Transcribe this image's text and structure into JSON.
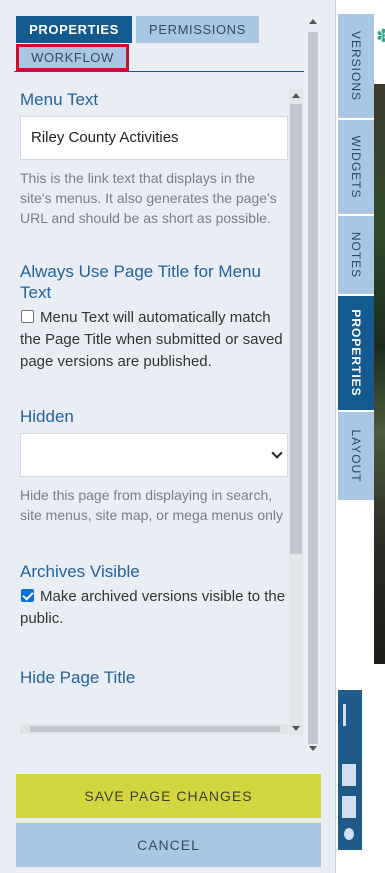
{
  "tabs": {
    "properties": "PROPERTIES",
    "permissions": "PERMISSIONS",
    "workflow": "WORKFLOW"
  },
  "menu_text": {
    "title": "Menu Text",
    "value": "Riley County Activities",
    "help": "This is the link text that displays in the site's menus. It also generates the page's URL and should be as short as possible."
  },
  "always_use_title": {
    "title": "Always Use Page Title for Menu Text",
    "checkbox_label": "Menu Text will automatically match the Page Title when submitted or saved page versions are published.",
    "checked": false
  },
  "hidden": {
    "title": "Hidden",
    "selected": "",
    "help": "Hide this page from displaying in search, site menus, site map, or mega menus only"
  },
  "archives_visible": {
    "title": "Archives Visible",
    "checkbox_label": "Make archived versions visible to the public.",
    "checked": true
  },
  "hide_page_title": {
    "title": "Hide Page Title"
  },
  "buttons": {
    "save": "SAVE PAGE CHANGES",
    "cancel": "CANCEL"
  },
  "side_tabs": {
    "versions": "VERSIONS",
    "widgets": "WIDGETS",
    "notes": "NOTES",
    "properties": "PROPERTIES",
    "layout": "LAYOUT"
  },
  "colors": {
    "accent": "#145a8e",
    "tab_inactive": "#a9c6e3",
    "save_button": "#d4d63f",
    "highlight_border": "#c8102e"
  }
}
